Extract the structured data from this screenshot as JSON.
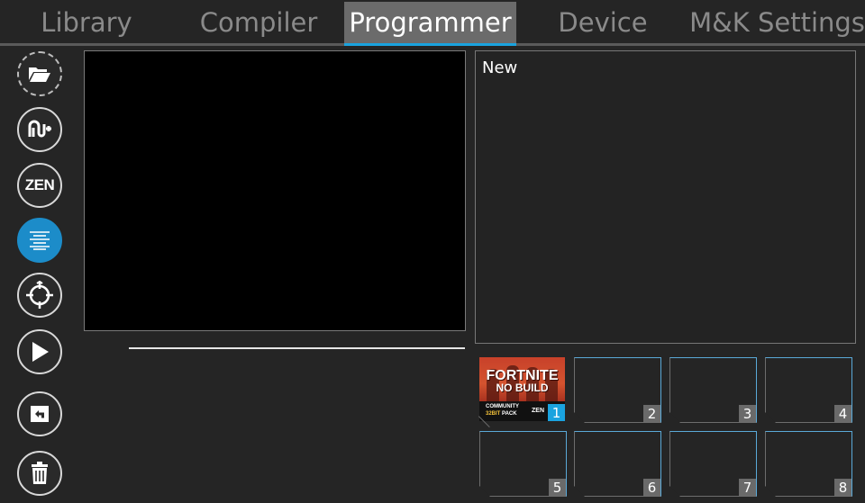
{
  "tabs": [
    {
      "label": "Library",
      "active": false
    },
    {
      "label": "Compiler",
      "active": false
    },
    {
      "label": "Programmer",
      "active": true
    },
    {
      "label": "Device",
      "active": false
    },
    {
      "label": "M&K Settings",
      "active": false
    }
  ],
  "toolbar": {
    "items": [
      {
        "name": "open-folder",
        "icon": "folder-open-icon"
      },
      {
        "name": "add-script",
        "icon": "gamepack-plus-icon"
      },
      {
        "name": "zen",
        "icon": "zen-icon",
        "label": "ZEN"
      },
      {
        "name": "align-text",
        "icon": "align-center-icon",
        "active": true
      },
      {
        "name": "sync",
        "icon": "sync-crosshair-icon"
      },
      {
        "name": "play",
        "icon": "play-icon"
      },
      {
        "name": "undo",
        "icon": "undo-icon"
      },
      {
        "name": "delete",
        "icon": "trash-icon"
      }
    ]
  },
  "info_panel": {
    "title": "New"
  },
  "slots": [
    {
      "number": "1",
      "filled": true,
      "active": true,
      "thumbnail": {
        "title_line1": "FORTNITE",
        "title_line2": "NO BUILD",
        "sub_line1": "COMMUNITY",
        "sub_line2_a": "32BIT",
        "sub_line2_b": " PACK",
        "badge": "ZEN"
      }
    },
    {
      "number": "2",
      "filled": false
    },
    {
      "number": "3",
      "filled": false
    },
    {
      "number": "4",
      "filled": false
    },
    {
      "number": "5",
      "filled": false
    },
    {
      "number": "6",
      "filled": false
    },
    {
      "number": "7",
      "filled": false
    },
    {
      "number": "8",
      "filled": false
    }
  ],
  "colors": {
    "accent": "#1aa3df",
    "background": "#252525",
    "active_tool": "#1c8cc9"
  }
}
